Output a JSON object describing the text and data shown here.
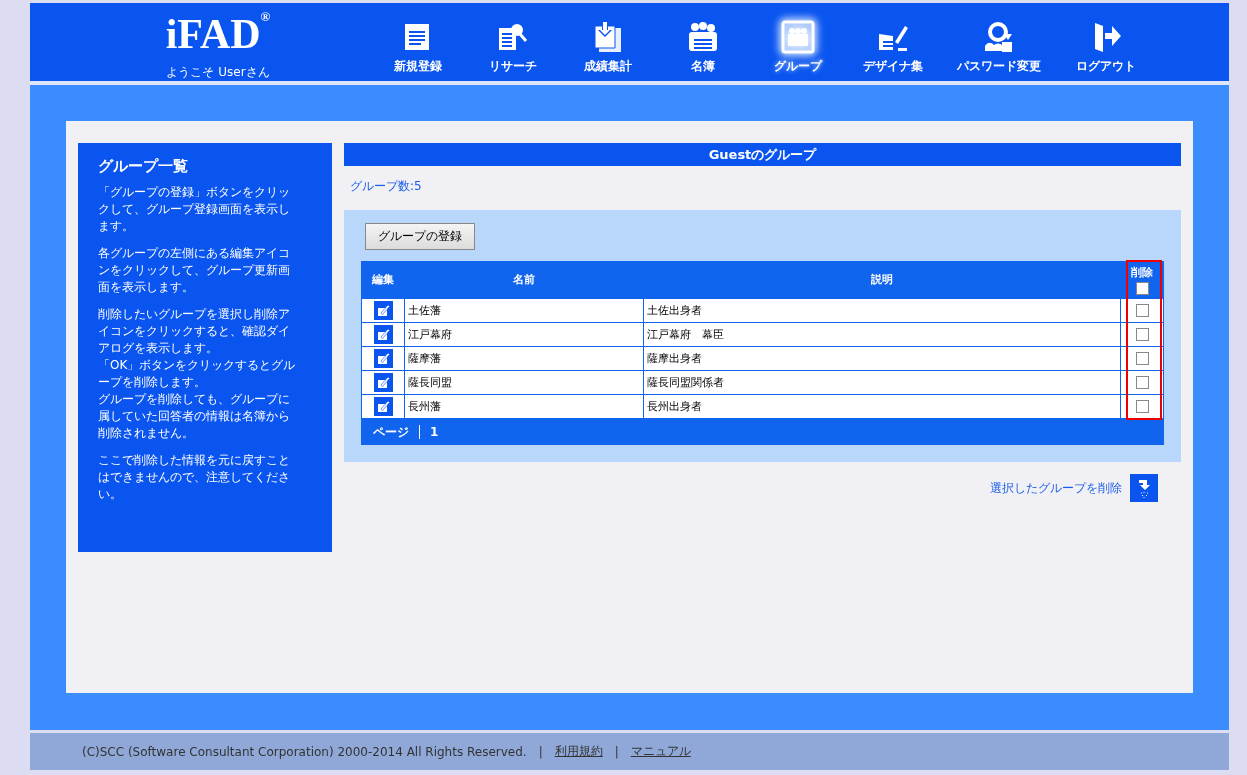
{
  "header": {
    "logo": "iFAD",
    "logo_mark": "®",
    "welcome": "ようこそ Userさん",
    "nav": [
      {
        "label": "新規登録",
        "kind": "register",
        "selected": false
      },
      {
        "label": "リサーチ",
        "kind": "research",
        "selected": false
      },
      {
        "label": "成績集計",
        "kind": "tally",
        "selected": false
      },
      {
        "label": "名簿",
        "kind": "roster",
        "selected": false
      },
      {
        "label": "グループ",
        "kind": "group",
        "selected": true
      },
      {
        "label": "デザイナ集",
        "kind": "designer",
        "selected": false
      },
      {
        "label": "パスワード変更",
        "kind": "password",
        "selected": false
      },
      {
        "label": "ログアウト",
        "kind": "logout",
        "selected": false
      }
    ]
  },
  "sidebar": {
    "title": "グループ一覧",
    "paragraphs": [
      [
        "「グループの登録」ボタンをクリックして、グループ登録画面を表示します。"
      ],
      [
        "各グループの左側にある編集アイコンをクリックして、グループ更新画面を表示します。"
      ],
      [
        "削除したいグループを選択し削除アイコンをクリックすると、確認ダイアログを表示します。",
        "「OK」ボタンをクリックするとグループを削除します。",
        "グループを削除しても、グループに属していた回答者の情報は名簿から削除されません。"
      ],
      [
        "ここで削除した情報を元に戻すことはできませんので、注意してください。"
      ]
    ]
  },
  "main": {
    "title": "Guestのグループ",
    "count": "グループ数:5",
    "register_button": "グループの登録",
    "table": {
      "columns": [
        "編集",
        "名前",
        "説明",
        "削除"
      ],
      "select_all_checked": false,
      "delete_column_highlighted": true,
      "rows": [
        {
          "name": "土佐藩",
          "description": "土佐出身者",
          "checked": false
        },
        {
          "name": "江戸幕府",
          "description": "江戸幕府　幕臣",
          "checked": false
        },
        {
          "name": "薩摩藩",
          "description": "薩摩出身者",
          "checked": false
        },
        {
          "name": "薩長同盟",
          "description": "薩長同盟関係者",
          "checked": false
        },
        {
          "name": "長州藩",
          "description": "長州出身者",
          "checked": false
        }
      ],
      "pager_label": "ページ",
      "pages": [
        "1"
      ]
    },
    "delete_link": "選択したグループを削除"
  },
  "footer": {
    "copyright": "(C)SCC (Software Consultant Corporation) 2000-2014 All Rights Reserved.",
    "links": [
      {
        "separator": "|",
        "label": "利用規約"
      },
      {
        "separator": "|",
        "label": "マニュアル"
      }
    ]
  }
}
